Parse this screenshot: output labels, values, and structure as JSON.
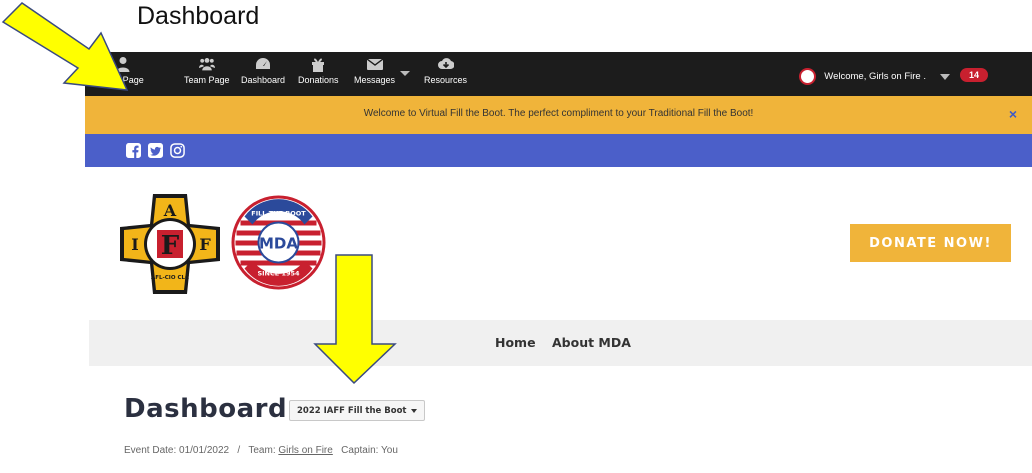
{
  "annotation": {
    "title": "Dashboard"
  },
  "topbar": {
    "items": [
      {
        "label": "Your Page",
        "icon": "user-icon"
      },
      {
        "label": "Team Page",
        "icon": "team-icon"
      },
      {
        "label": "Dashboard",
        "icon": "dashboard-icon"
      },
      {
        "label": "Donations",
        "icon": "gift-icon"
      },
      {
        "label": "Messages",
        "icon": "envelope-icon"
      },
      {
        "label": "Resources",
        "icon": "cloud-download-icon"
      }
    ],
    "welcome": "Welcome, Girls on Fire .",
    "badge_count": "14"
  },
  "alert": {
    "text": "Welcome to Virtual Fill the Boot.  The perfect compliment to your Traditional Fill the Boot!",
    "close": "×"
  },
  "header": {
    "donate_label": "DONATE NOW!"
  },
  "logos": {
    "iaff": {
      "letters": [
        "I",
        "A",
        "F",
        "F"
      ],
      "sub": "AFL-CIO CLC"
    },
    "mda": {
      "top": "FILL THE BOOT",
      "center": "MDA",
      "bottom": "SINCE 1954"
    }
  },
  "menu": {
    "home": "Home",
    "about": "About MDA"
  },
  "dashboard": {
    "title": "Dashboard",
    "event_select": "2022 IAFF Fill the Boot",
    "event_date_label": "Event Date: 01/01/2022",
    "separator": "/",
    "team_label": "Team:",
    "team_name": "Girls on Fire",
    "captain": "Captain: You"
  },
  "colors": {
    "accent": "#f0b43a",
    "nav": "#1c1c1c",
    "social": "#4b5fc9",
    "badge": "#c8202f",
    "arrow": "#ffff00"
  }
}
